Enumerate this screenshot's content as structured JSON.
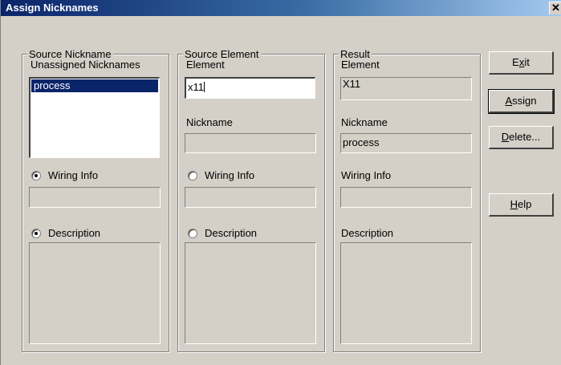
{
  "window": {
    "title": "Assign Nicknames",
    "close_glyph": "✕"
  },
  "source_nickname": {
    "legend": "Source Nickname",
    "list_label": "Unassigned Nicknames",
    "list_items": [
      "process"
    ],
    "wiring_label": "Wiring Info",
    "wiring_checked": true,
    "wiring_value": "",
    "description_label": "Description",
    "description_checked": true,
    "description_value": ""
  },
  "source_element": {
    "legend": "Source Element",
    "element_label": "Element",
    "element_value": "x11",
    "nickname_label": "Nickname",
    "nickname_value": "",
    "wiring_label": "Wiring Info",
    "wiring_checked": false,
    "wiring_value": "",
    "description_label": "Description",
    "description_checked": false,
    "description_value": ""
  },
  "result": {
    "legend": "Result",
    "element_label": "Element",
    "element_value": "X11",
    "nickname_label": "Nickname",
    "nickname_value": "process",
    "wiring_label": "Wiring Info",
    "wiring_value": "",
    "description_label": "Description",
    "description_value": ""
  },
  "buttons": {
    "exit": {
      "pre": "E",
      "accel": "x",
      "post": "it"
    },
    "assign": {
      "pre": "",
      "accel": "A",
      "post": "ssign"
    },
    "delete": {
      "pre": "",
      "accel": "D",
      "post": "elete..."
    },
    "help": {
      "pre": "",
      "accel": "H",
      "post": "elp"
    }
  }
}
